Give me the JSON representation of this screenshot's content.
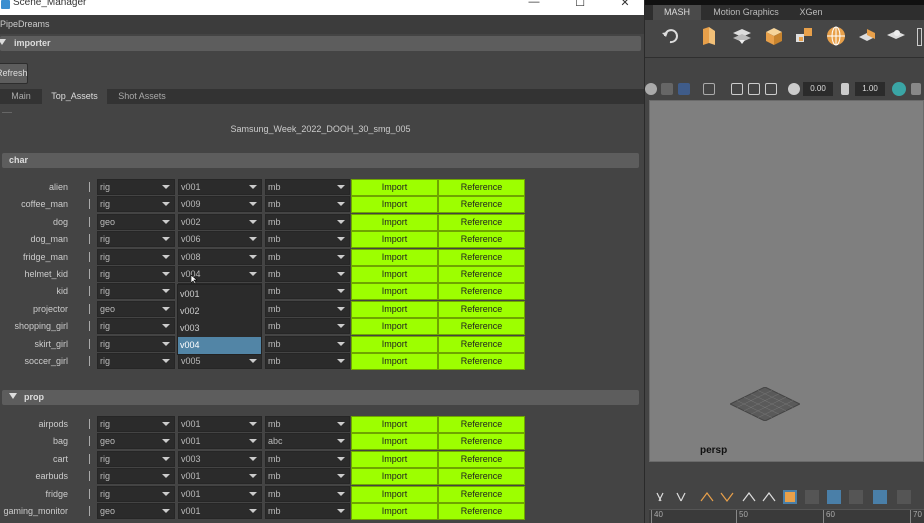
{
  "window": {
    "title": "Scene_Manager",
    "controls": [
      "—",
      "☐",
      "✕"
    ]
  },
  "menu": {
    "label": "PipeDreams"
  },
  "importer": {
    "header": "importer",
    "refresh_label": "Refresh"
  },
  "tabs": [
    {
      "label": "Main",
      "active": false
    },
    {
      "label": "Top_Assets",
      "active": true
    },
    {
      "label": "Shot Assets",
      "active": false
    }
  ],
  "scene_name": "Samsung_Week_2022_DOOH_30_smg_005",
  "buttons": {
    "import": "Import",
    "reference": "Reference"
  },
  "colors": {
    "button_green": "#9dff00",
    "selection_blue": "#5285a6"
  },
  "char": {
    "header": "char",
    "rows": [
      {
        "name": "alien",
        "type": "rig",
        "version": "v001",
        "format": "mb"
      },
      {
        "name": "coffee_man",
        "type": "rig",
        "version": "v009",
        "format": "mb"
      },
      {
        "name": "dog",
        "type": "geo",
        "version": "v002",
        "format": "mb"
      },
      {
        "name": "dog_man",
        "type": "rig",
        "version": "v006",
        "format": "mb"
      },
      {
        "name": "fridge_man",
        "type": "rig",
        "version": "v008",
        "format": "mb"
      },
      {
        "name": "helmet_kid",
        "type": "rig",
        "version": "v004",
        "format": "mb"
      },
      {
        "name": "kid",
        "type": "rig",
        "version": "",
        "format": "mb"
      },
      {
        "name": "projector",
        "type": "geo",
        "version": "",
        "format": "mb"
      },
      {
        "name": "shopping_girl",
        "type": "rig",
        "version": "",
        "format": "mb"
      },
      {
        "name": "skirt_girl",
        "type": "rig",
        "version": "",
        "format": "mb"
      },
      {
        "name": "soccer_girl",
        "type": "rig",
        "version": "v005",
        "format": "mb"
      }
    ]
  },
  "version_popup": {
    "options": [
      "v001",
      "v002",
      "v003",
      "v004"
    ],
    "selected": "v004"
  },
  "prop": {
    "header": "prop",
    "rows": [
      {
        "name": "airpods",
        "type": "rig",
        "version": "v001",
        "format": "mb"
      },
      {
        "name": "bag",
        "type": "geo",
        "version": "v001",
        "format": "abc"
      },
      {
        "name": "cart",
        "type": "rig",
        "version": "v003",
        "format": "mb"
      },
      {
        "name": "earbuds",
        "type": "rig",
        "version": "v001",
        "format": "mb"
      },
      {
        "name": "fridge",
        "type": "rig",
        "version": "v001",
        "format": "mb"
      },
      {
        "name": "gaming_monitor",
        "type": "geo",
        "version": "v001",
        "format": "mb"
      }
    ]
  },
  "maya": {
    "shelf_tabs": [
      {
        "label": "MASH",
        "active": true
      },
      {
        "label": "Motion Graphics",
        "active": false
      },
      {
        "label": "XGen",
        "active": false
      }
    ],
    "field_a": "0.00",
    "field_b": "1.00",
    "camera_label": "persp",
    "timeline_ticks": [
      "40",
      "50",
      "60",
      "70"
    ]
  }
}
